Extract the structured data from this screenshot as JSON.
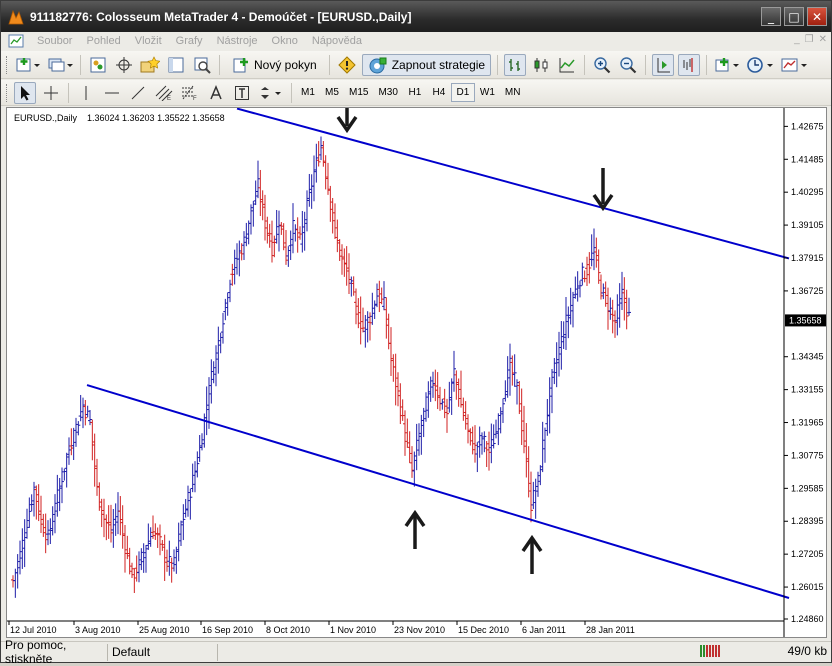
{
  "window": {
    "title": "911182776: Colosseum MetaTrader 4 - Demoúčet - [EURUSD.,Daily]",
    "minimize": "_",
    "maximize": "□",
    "close": "✕"
  },
  "menu": {
    "items": [
      "Soubor",
      "Pohled",
      "Vložit",
      "Grafy",
      "Nástroje",
      "Okno",
      "Nápověda"
    ],
    "mdi_min": "_",
    "mdi_restore": "❐",
    "mdi_close": "✕"
  },
  "toolbar": {
    "new_order_label": "Nový pokyn",
    "strategy_label": "Zapnout strategie"
  },
  "timeframes": [
    {
      "label": "M1",
      "active": false
    },
    {
      "label": "M5",
      "active": false
    },
    {
      "label": "M15",
      "active": false
    },
    {
      "label": "M30",
      "active": false
    },
    {
      "label": "H1",
      "active": false
    },
    {
      "label": "H4",
      "active": false
    },
    {
      "label": "D1",
      "active": true
    },
    {
      "label": "W1",
      "active": false
    },
    {
      "label": "MN",
      "active": false
    }
  ],
  "chart_data": {
    "type": "bar",
    "symbol_label": "EURUSD.,Daily",
    "ohlc_label": "1.36024 1.36203 1.35522 1.35658",
    "current_price_label": "1.35658",
    "y_ticks": [
      "1.42675",
      "1.41485",
      "1.40295",
      "1.39105",
      "1.37915",
      "1.36725",
      "1.34345",
      "1.33155",
      "1.31965",
      "1.30775",
      "1.29585",
      "1.28395",
      "1.27205",
      "1.26015",
      "1.24860"
    ],
    "y_tick_values": [
      1.42675,
      1.41485,
      1.40295,
      1.39105,
      1.37915,
      1.36725,
      1.34345,
      1.33155,
      1.31965,
      1.30775,
      1.29585,
      1.28395,
      1.27205,
      1.26015,
      1.2486
    ],
    "ylim": [
      1.2486,
      1.4305
    ],
    "x_ticks": [
      "12 Jul 2010",
      "3 Aug 2010",
      "25 Aug 2010",
      "16 Sep 2010",
      "8 Oct 2010",
      "1 Nov 2010",
      "23 Nov 2010",
      "15 Dec 2010",
      "6 Jan 2011",
      "28 Jan 2011"
    ],
    "colors": {
      "bull": "#1c1ca8",
      "bear": "#d02020",
      "trendline": "#0000cc",
      "arrow": "#1a1a1a"
    },
    "close_path": [
      [
        0,
        1.2625
      ],
      [
        3,
        1.272
      ],
      [
        6,
        1.284
      ],
      [
        9,
        1.296
      ],
      [
        12,
        1.284
      ],
      [
        15,
        1.278
      ],
      [
        18,
        1.289
      ],
      [
        21,
        1.3
      ],
      [
        24,
        1.31
      ],
      [
        27,
        1.318
      ],
      [
        30,
        1.326
      ],
      [
        33,
        1.32
      ],
      [
        36,
        1.295
      ],
      [
        39,
        1.285
      ],
      [
        42,
        1.28
      ],
      [
        45,
        1.288
      ],
      [
        48,
        1.275
      ],
      [
        51,
        1.264
      ],
      [
        54,
        1.268
      ],
      [
        57,
        1.275
      ],
      [
        60,
        1.281
      ],
      [
        63,
        1.276
      ],
      [
        66,
        1.269
      ],
      [
        69,
        1.268
      ],
      [
        72,
        1.282
      ],
      [
        75,
        1.292
      ],
      [
        78,
        1.302
      ],
      [
        81,
        1.315
      ],
      [
        84,
        1.332
      ],
      [
        87,
        1.344
      ],
      [
        90,
        1.358
      ],
      [
        93,
        1.372
      ],
      [
        96,
        1.379
      ],
      [
        99,
        1.385
      ],
      [
        102,
        1.396
      ],
      [
        105,
        1.405
      ],
      [
        108,
        1.392
      ],
      [
        111,
        1.383
      ],
      [
        114,
        1.393
      ],
      [
        117,
        1.38
      ],
      [
        120,
        1.39
      ],
      [
        123,
        1.385
      ],
      [
        126,
        1.398
      ],
      [
        129,
        1.41
      ],
      [
        132,
        1.42
      ],
      [
        135,
        1.405
      ],
      [
        138,
        1.388
      ],
      [
        141,
        1.378
      ],
      [
        144,
        1.372
      ],
      [
        147,
        1.36
      ],
      [
        150,
        1.354
      ],
      [
        153,
        1.358
      ],
      [
        156,
        1.366
      ],
      [
        159,
        1.362
      ],
      [
        162,
        1.342
      ],
      [
        165,
        1.33
      ],
      [
        168,
        1.315
      ],
      [
        171,
        1.302
      ],
      [
        174,
        1.315
      ],
      [
        177,
        1.326
      ],
      [
        180,
        1.335
      ],
      [
        183,
        1.328
      ],
      [
        186,
        1.323
      ],
      [
        189,
        1.338
      ],
      [
        192,
        1.326
      ],
      [
        195,
        1.316
      ],
      [
        198,
        1.31
      ],
      [
        201,
        1.314
      ],
      [
        204,
        1.309
      ],
      [
        207,
        1.316
      ],
      [
        210,
        1.329
      ],
      [
        213,
        1.34
      ],
      [
        216,
        1.332
      ],
      [
        219,
        1.312
      ],
      [
        222,
        1.29
      ],
      [
        225,
        1.298
      ],
      [
        228,
        1.318
      ],
      [
        231,
        1.335
      ],
      [
        234,
        1.346
      ],
      [
        237,
        1.356
      ],
      [
        240,
        1.365
      ],
      [
        243,
        1.372
      ],
      [
        246,
        1.375
      ],
      [
        249,
        1.382
      ],
      [
        252,
        1.368
      ],
      [
        255,
        1.362
      ],
      [
        258,
        1.356
      ],
      [
        261,
        1.366
      ],
      [
        264,
        1.358
      ]
    ],
    "trendlines": [
      {
        "x": [
          0,
          1.0
        ],
        "y": [
          1.4332,
          1.379
        ]
      },
      {
        "x": [
          0,
          1.0
        ],
        "y": [
          1.3332,
          1.2562
        ]
      }
    ],
    "arrows": [
      {
        "dir": "down",
        "at": "upper-start"
      },
      {
        "dir": "down",
        "at": "upper-right"
      },
      {
        "dir": "up",
        "at": "lower-mid"
      },
      {
        "dir": "up",
        "at": "lower-right"
      }
    ]
  },
  "status": {
    "help_text": "Pro pomoc, stiskněte",
    "profile": "Default",
    "traffic": "49/0 kb"
  }
}
